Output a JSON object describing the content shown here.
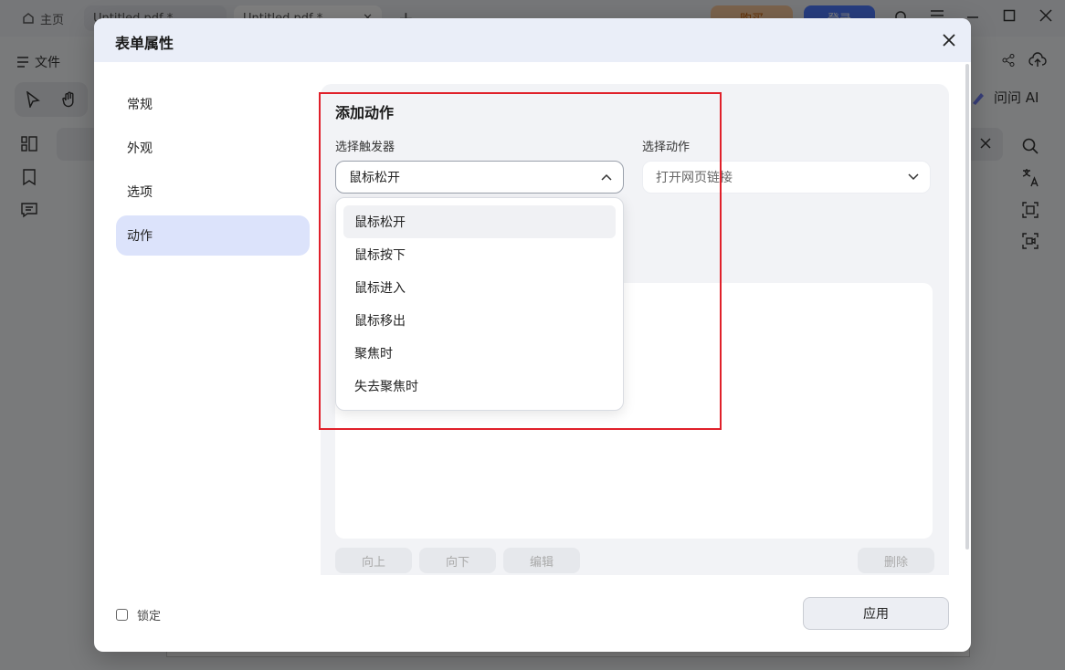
{
  "background": {
    "tabs": {
      "home": "主页",
      "doc1": "Untitled.pdf *",
      "doc2": "Untitled.pdf *"
    },
    "buy_label": "购买",
    "login_label": "登录",
    "file_menu": "文件",
    "ask_ai": "问问 AI"
  },
  "dialog": {
    "title": "表单属性",
    "nav": [
      {
        "label": "常规"
      },
      {
        "label": "外观"
      },
      {
        "label": "选项"
      },
      {
        "label": "动作",
        "active": true
      }
    ],
    "section_title": "添加动作",
    "trigger_label": "选择触发器",
    "trigger_value": "鼠标松开",
    "action_label": "选择动作",
    "action_value": "打开网页链接",
    "trigger_options": [
      "鼠标松开",
      "鼠标按下",
      "鼠标进入",
      "鼠标移出",
      "聚焦时",
      "失去聚焦时"
    ],
    "buttons": {
      "up": "向上",
      "down": "向下",
      "edit": "编辑",
      "delete": "删除"
    },
    "lock_label": "锁定",
    "apply_label": "应用"
  },
  "colors": {
    "highlight": "#e0202a",
    "nav_active": "#dce3fb",
    "header": "#eaeef8"
  }
}
